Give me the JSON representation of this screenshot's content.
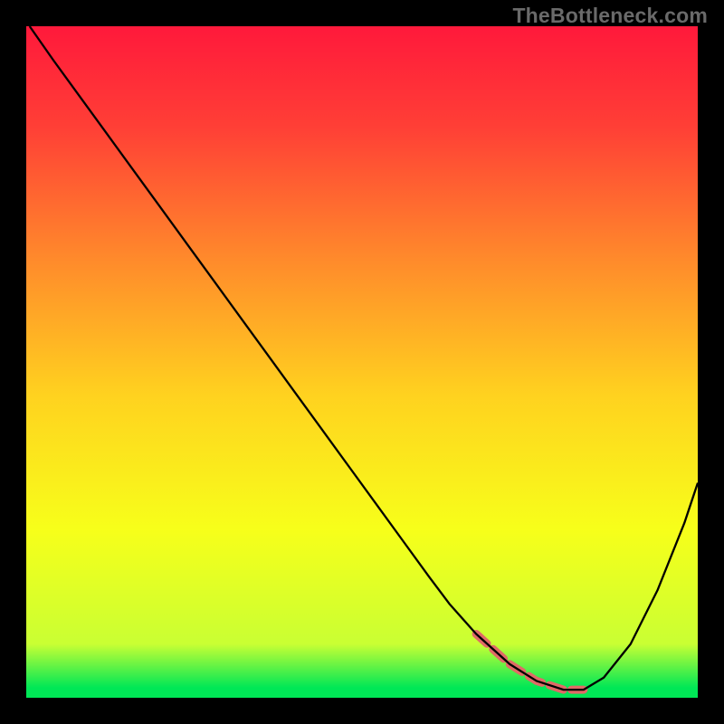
{
  "watermark": "TheBottleneck.com",
  "chart_data": {
    "type": "line",
    "title": "",
    "xlabel": "",
    "ylabel": "",
    "xlim": [
      0,
      100
    ],
    "ylim": [
      0,
      100
    ],
    "background_gradient": {
      "stops": [
        {
          "offset": 0.0,
          "color": "#ff193b"
        },
        {
          "offset": 0.15,
          "color": "#ff3f36"
        },
        {
          "offset": 0.35,
          "color": "#ff8b2b"
        },
        {
          "offset": 0.55,
          "color": "#ffd21f"
        },
        {
          "offset": 0.75,
          "color": "#f7ff1a"
        },
        {
          "offset": 0.92,
          "color": "#c9ff33"
        },
        {
          "offset": 0.985,
          "color": "#00e756"
        },
        {
          "offset": 1.0,
          "color": "#00e756"
        }
      ]
    },
    "series": [
      {
        "name": "bottleneck-curve",
        "color": "#000000",
        "stroke_width": 2.3,
        "x": [
          0.5,
          4,
          8,
          12,
          16,
          20,
          24,
          28,
          32,
          36,
          40,
          44,
          48,
          52,
          56,
          60,
          63,
          67,
          72,
          76,
          80,
          83,
          86,
          90,
          94,
          98,
          100
        ],
        "y": [
          100,
          95,
          89.5,
          84,
          78.5,
          73,
          67.5,
          62,
          56.5,
          51,
          45.5,
          40,
          34.5,
          29,
          23.5,
          18,
          14,
          9.5,
          5,
          2.5,
          1.2,
          1.2,
          3,
          8,
          16,
          26,
          32
        ]
      }
    ],
    "highlight_segment": {
      "name": "optimal-range",
      "color": "#e06a66",
      "stroke_width": 9,
      "dash": [
        16,
        9
      ],
      "x": [
        67,
        72,
        76,
        80,
        83
      ],
      "y": [
        9.5,
        5,
        2.5,
        1.2,
        1.2
      ]
    }
  }
}
